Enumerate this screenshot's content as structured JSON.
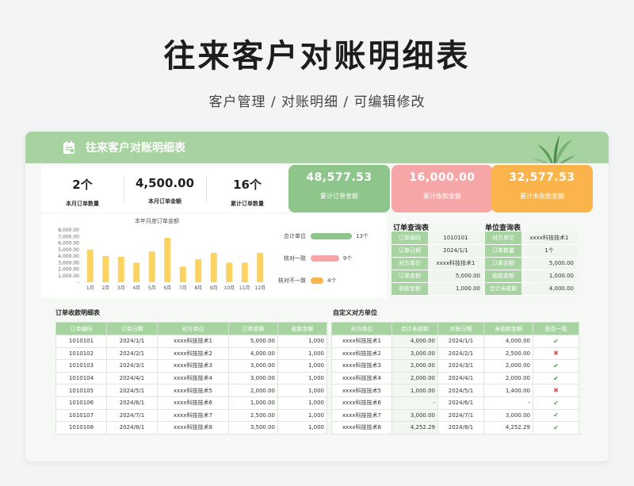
{
  "page": {
    "title": "往来客户对账明细表",
    "subtitle": "客户管理 / 对账明细 / 可编辑修改"
  },
  "card": {
    "title": "往来客户对账明细表"
  },
  "stats": [
    {
      "value": "2个",
      "label": "本月订单数量"
    },
    {
      "value": "4,500.00",
      "label": "本月订单金额"
    },
    {
      "value": "16个",
      "label": "累计订单数量"
    }
  ],
  "kpis": [
    {
      "value": "48,577.53",
      "label": "累计订单金额",
      "color": "#8dc58a"
    },
    {
      "value": "16,000.00",
      "label": "累计收款金额",
      "color": "#f6a6a6"
    },
    {
      "value": "32,577.53",
      "label": "累计未收款金额",
      "color": "#fbb44c"
    }
  ],
  "chart_data": {
    "type": "bar",
    "title": "本年月度订单金额",
    "categories": [
      "1月",
      "2月",
      "3月",
      "4月",
      "5月",
      "6月",
      "7月",
      "8月",
      "9月",
      "10月",
      "11月",
      "12月"
    ],
    "values": [
      5000,
      4000,
      3900,
      3000,
      4700,
      6800,
      2400,
      3500,
      4500,
      3000,
      3000,
      4500
    ],
    "yticks": [
      "8,000.00",
      "7,000.00",
      "6,000.00",
      "5,000.00",
      "4,000.00",
      "3,000.00",
      "2,000.00",
      "1,000.00",
      "-"
    ],
    "ylim": [
      0,
      8000
    ],
    "color": "#fbd363"
  },
  "progress": [
    {
      "label": "合计单位",
      "value": "13个",
      "fraction": 1.0,
      "color": "#8dc58a"
    },
    {
      "label": "核对一致",
      "value": "9个",
      "fraction": 0.69,
      "color": "#f6a6a6"
    },
    {
      "label": "核对不一致",
      "value": "4个",
      "fraction": 0.31,
      "color": "#fbb44c"
    }
  ],
  "order_query": {
    "title": "订单查询表",
    "rows": [
      {
        "k": "订单编码",
        "v": "1010101"
      },
      {
        "k": "订单日期",
        "v": "2024/1/1"
      },
      {
        "k": "对方单位",
        "v": "xxxx科技技术1"
      },
      {
        "k": "订单金额",
        "v": "5,000.00"
      },
      {
        "k": "收款金额",
        "v": "1,000.00"
      }
    ]
  },
  "unit_query": {
    "title": "单位查询表",
    "rows": [
      {
        "k": "对方单位",
        "v": "xxxx科技技术1"
      },
      {
        "k": "订单数量",
        "v": "1个"
      },
      {
        "k": "订单金额",
        "v": "5,000.00"
      },
      {
        "k": "收款金额",
        "v": "1,000.00"
      },
      {
        "k": "合计未收款",
        "v": "4,000.00"
      }
    ]
  },
  "detail": {
    "title": "订单收款明细表",
    "headers": [
      "订单编码",
      "订单日期",
      "对方单位",
      "订单金额",
      "收款金额"
    ],
    "rows": [
      [
        "1010101",
        "2024/1/1",
        "xxxx科技技术1",
        "5,000.00",
        "1,000"
      ],
      [
        "1010102",
        "2024/2/1",
        "xxxx科技技术2",
        "4,000.00",
        "1,000"
      ],
      [
        "1010103",
        "2024/3/1",
        "xxxx科技技术3",
        "3,000.00",
        "1,000"
      ],
      [
        "1010104",
        "2024/4/1",
        "xxxx科技技术4",
        "3,000.00",
        "1,000"
      ],
      [
        "1010105",
        "2024/5/1",
        "xxxx科技技术5",
        "2,000.00",
        "1,000"
      ],
      [
        "1010106",
        "2024/6/1",
        "xxxx科技技术6",
        "1,000.00",
        "1,000"
      ],
      [
        "1010107",
        "2024/7/1",
        "xxxx科技技术7",
        "2,500.00",
        "1,000"
      ],
      [
        "1010108",
        "2024/8/1",
        "xxxx科技技术8",
        "3,500.00",
        "1,000"
      ]
    ]
  },
  "custom": {
    "title": "自定义对方单位",
    "headers": [
      "对方单位",
      "合计未收款",
      "对账日期",
      "未收款金额",
      "是否一致"
    ],
    "rows": [
      [
        "xxxx科技技术1",
        "4,000.00",
        "2024/1/1",
        "4,000.00",
        "ok"
      ],
      [
        "xxxx科技技术2",
        "3,000.00",
        "2024/2/1",
        "2,500.00",
        "bad"
      ],
      [
        "xxxx科技技术3",
        "2,000.00",
        "2024/3/1",
        "2,000.00",
        "ok"
      ],
      [
        "xxxx科技技术4",
        "2,000.00",
        "2024/4/1",
        "2,000.00",
        "ok"
      ],
      [
        "xxxx科技技术5",
        "1,000.00",
        "2024/5/1",
        "1,400.00",
        "bad"
      ],
      [
        "xxxx科技技术6",
        "-",
        "2024/6/1",
        "-",
        "ok"
      ],
      [
        "xxxx科技技术7",
        "3,000.00",
        "2024/7/1",
        "3,000.00",
        "ok"
      ],
      [
        "xxxx科技技术8",
        "4,252.29",
        "2024/8/1",
        "4,252.29",
        "ok"
      ]
    ],
    "symbols": {
      "ok": "✔",
      "bad": "✖"
    }
  }
}
